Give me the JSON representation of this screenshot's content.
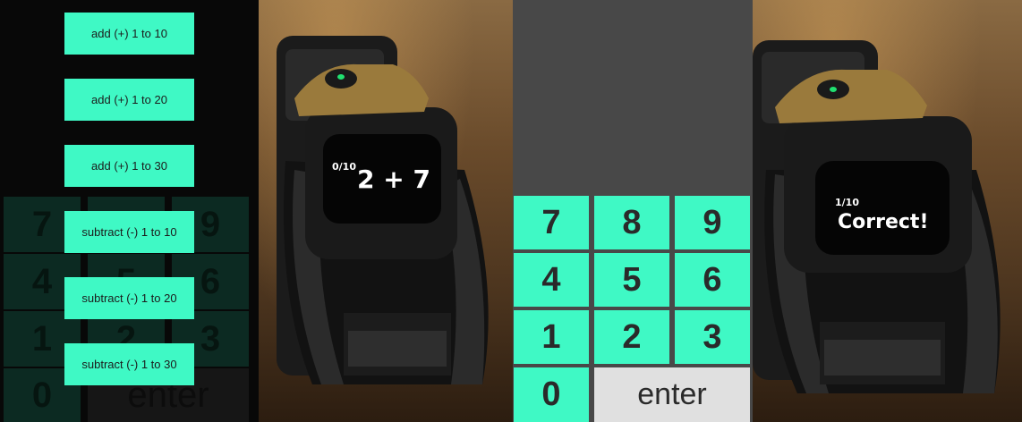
{
  "menu": {
    "buttons": [
      "add (+) 1 to 10",
      "add (+) 1 to 20",
      "add (+) 1 to 30",
      "subtract (-) 1 to 10",
      "subtract (-) 1 to 20",
      "subtract (-) 1 to 30"
    ]
  },
  "background_keypad": {
    "keys": [
      "7",
      "8",
      "9",
      "4",
      "5",
      "6",
      "1",
      "2",
      "3",
      "0",
      "enter"
    ]
  },
  "robot_screen_1": {
    "progress": "0/10",
    "problem": "2 + 7"
  },
  "keypad": {
    "keys": [
      "7",
      "8",
      "9",
      "4",
      "5",
      "6",
      "1",
      "2",
      "3",
      "0"
    ],
    "enter_label": "enter"
  },
  "robot_screen_2": {
    "progress": "1/10",
    "result": "Correct!"
  },
  "colors": {
    "accent": "#3ff9c5",
    "enter_key": "#e0e0e0",
    "keypad_background": "#484848",
    "menu_background": "#080808",
    "robot_led": "#20e070"
  },
  "icons": [
    "robot-photo",
    "green-led-icon"
  ]
}
